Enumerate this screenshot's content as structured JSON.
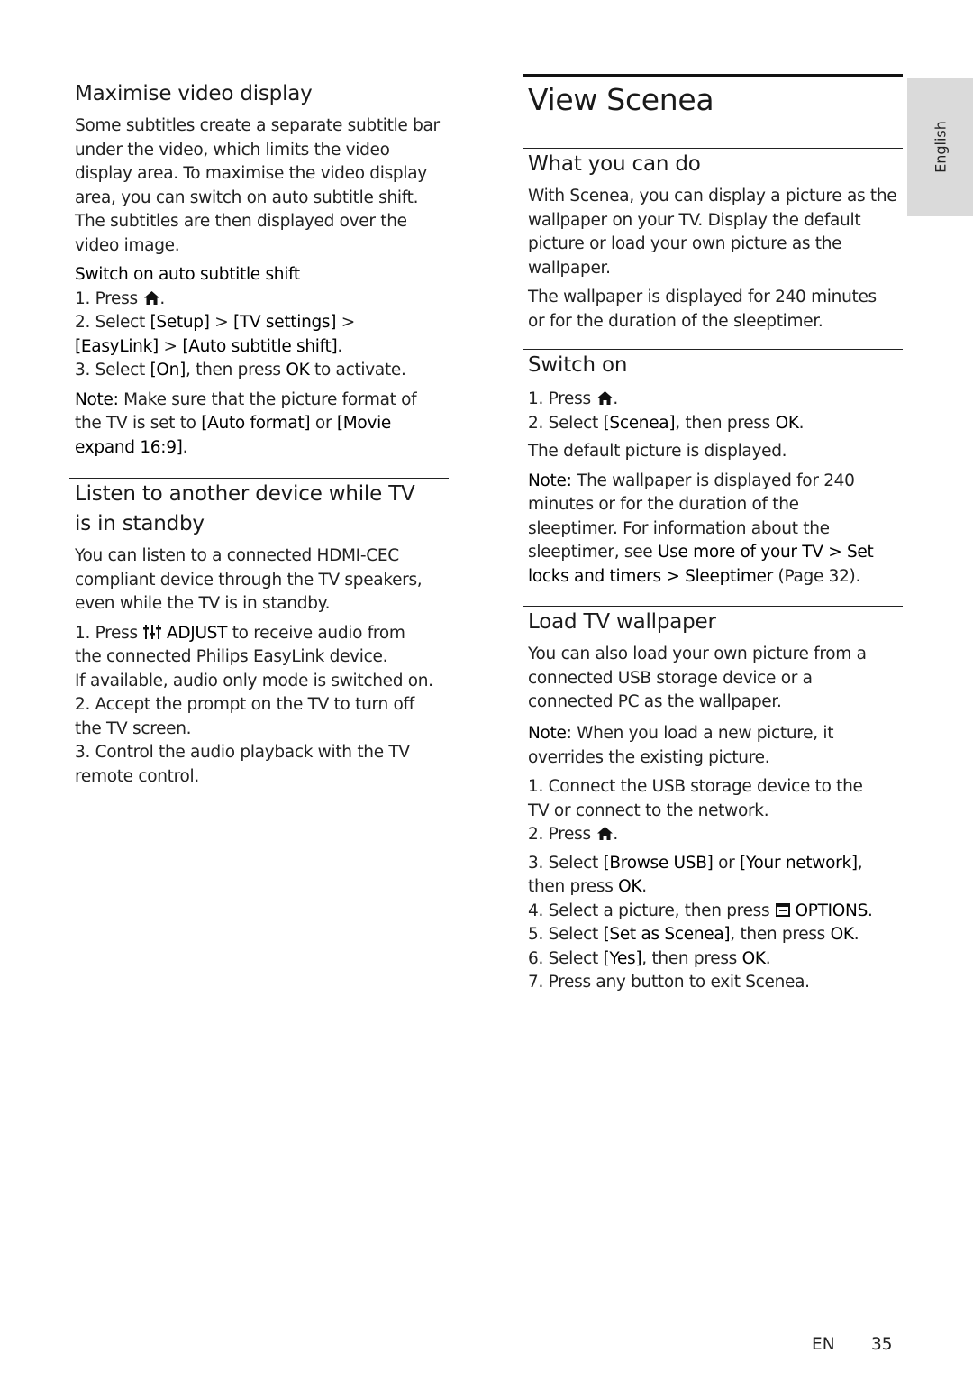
{
  "left_column": {
    "maximise": {
      "heading": "Maximise video display",
      "intro_lines": [
        "Some subtitles create a separate subtitle bar",
        "under the video, which limits the video",
        "display area. To maximise the video display",
        "area, you can switch on auto subtitle shift.",
        "The subtitles are then displayed over the",
        "video image."
      ],
      "subheading": "Switch on auto subtitle shift",
      "step1": {
        "prefix": "1. Press ",
        "icon": "home-icon",
        "suffix": "."
      },
      "step2_line1": {
        "prefix": "2. Select ",
        "a": "[Setup]",
        "sep1": " > ",
        "b": "[TV settings]",
        "sep2": " >"
      },
      "step2_line2": {
        "a": "[EasyLink]",
        "sep": " > ",
        "b": "[Auto subtitle shift]",
        "suffix": "."
      },
      "step3": {
        "prefix": "3. Select ",
        "a": "[On]",
        "middle": ", then press ",
        "b": "OK",
        "suffix": " to activate."
      },
      "note": {
        "label": "Note:",
        "line1": " Make sure that the picture format of",
        "line2_prefix": "the TV is set to ",
        "line2_a": "[Auto format]",
        "line2_mid": " or ",
        "line2_b": "[Movie",
        "line3_b": "expand 16:9]",
        "line3_suffix": "."
      }
    },
    "listen": {
      "heading_line1": "Listen to another device while TV",
      "heading_line2": "is in standby",
      "intro_lines": [
        "You can listen to a connected HDMI-CEC",
        "compliant device through the TV speakers,",
        "even while the TV is in standby."
      ],
      "step1_line1": {
        "prefix": "1. Press ",
        "icon": "adjust-icon",
        "key": " ADJUST",
        "suffix": " to receive audio from"
      },
      "step1_line2": "the connected Philips EasyLink device.",
      "step1_line3": "If available, audio only mode is switched on.",
      "step2_lines": [
        "2. Accept the prompt on the TV to turn off",
        "the TV screen."
      ],
      "step3_lines": [
        "3. Control the audio playback with the TV",
        "remote control."
      ]
    }
  },
  "right_column": {
    "title": "View Scenea",
    "what": {
      "heading": "What you can do",
      "intro_lines": [
        "With Scenea, you can display a picture as the",
        "wallpaper on your TV. Display the default",
        "picture or load your own picture as the",
        "wallpaper."
      ],
      "duration_lines": [
        "The wallpaper is displayed for 240 minutes",
        "or for the duration of the sleeptimer."
      ]
    },
    "switch_on": {
      "heading": "Switch on",
      "step1": {
        "prefix": "1. Press ",
        "icon": "home-icon",
        "suffix": "."
      },
      "step2": {
        "prefix": "2. Select ",
        "a": "[Scenea]",
        "middle": ", then press ",
        "b": "OK",
        "suffix": "."
      },
      "result": "The default picture is displayed.",
      "note": {
        "label": "Note:",
        "line1": " The wallpaper is displayed for 240",
        "line2": "minutes or for the duration of the",
        "line3": "sleeptimer. For information about the",
        "line4_prefix": "sleeptimer, see ",
        "line4_link": "Use more of your TV > Set",
        "line5_link": "locks and timers > Sleeptimer",
        "line5_suffix": " (Page 32)."
      }
    },
    "load": {
      "heading": "Load TV wallpaper",
      "intro_lines": [
        "You can also load your own picture from a",
        "connected USB storage device or a",
        "connected PC as the wallpaper."
      ],
      "note": {
        "label": "Note",
        "line1": ": When you load a new picture, it",
        "line2": "overrides the existing picture."
      },
      "step1_lines": [
        "1. Connect the USB storage device to the",
        "TV or connect to the network."
      ],
      "step2": {
        "prefix": "2. Press ",
        "icon": "home-icon",
        "suffix": "."
      },
      "step3_line1": {
        "prefix": "3. Select ",
        "a": "[Browse USB]",
        "mid": " or ",
        "b": "[Your network]",
        "suffix": ","
      },
      "step3_line2": {
        "prefix": "then press ",
        "b": "OK",
        "suffix": "."
      },
      "step4": {
        "prefix": "4. Select a picture, then press ",
        "icon": "options-icon",
        "key": " OPTIONS",
        "suffix": "."
      },
      "step5": {
        "prefix": "5. Select ",
        "a": "[Set as Scenea]",
        "middle": ", then press ",
        "b": "OK",
        "suffix": "."
      },
      "step6": {
        "prefix": "6. Select ",
        "a": "[Yes]",
        "middle": ", then press ",
        "b": "OK",
        "suffix": "."
      },
      "step7": "7. Press any button to exit Scenea."
    }
  },
  "side_tab": {
    "label": "English",
    "color": "#dadada"
  },
  "footer": {
    "lang": "EN",
    "page": "35"
  }
}
